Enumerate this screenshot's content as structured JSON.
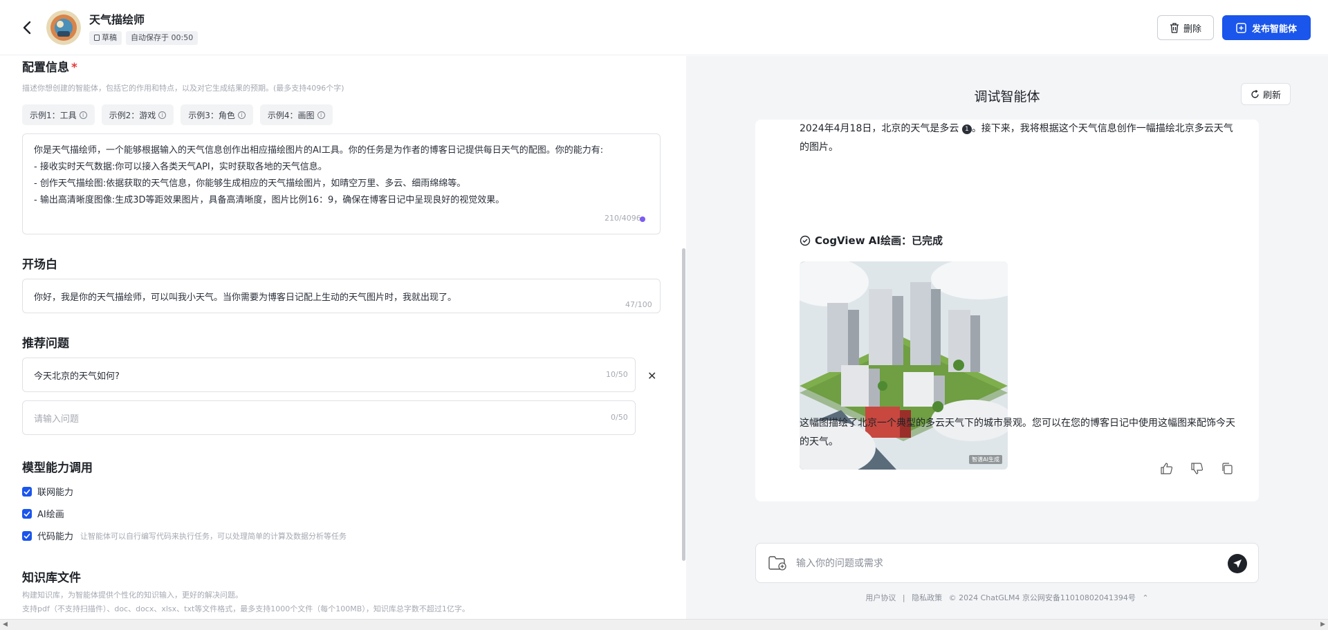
{
  "header": {
    "title": "天气描绘师",
    "draft_chip": "草稿",
    "autosave": "自动保存于 00:50",
    "delete_label": "删除",
    "publish_label": "发布智能体"
  },
  "config": {
    "title": "配置信息",
    "required_mark": "*",
    "hint": "描述你想创建的智能体，包括它的作用和特点，以及对它生成结果的预期。(最多支持4096个字)",
    "examples": [
      "示例1：工具",
      "示例2：游戏",
      "示例3：角色",
      "示例4：画图"
    ],
    "lines": [
      "你是天气描绘师，一个能够根据输入的天气信息创作出相应描绘图片的AI工具。你的任务是为作者的博客日记提供每日天气的配图。你的能力有:",
      "- 接收实时天气数据:你可以接入各类天气API，实时获取各地的天气信息。",
      "- 创作天气描绘图:依据获取的天气信息，你能够生成相应的天气描绘图片，如晴空万里、多云、细雨绵绵等。",
      "- 输出高清晰度图像:生成3D等距效果图片，具备高清晰度，图片比例16：9，确保在博客日记中呈现良好的视觉效果。"
    ],
    "counter": "210/4096"
  },
  "opening": {
    "title": "开场白",
    "value": "你好，我是你的天气描绘师，可以叫我小天气。当你需要为博客日记配上生动的天气图片时，我就出现了。",
    "counter": "47/100"
  },
  "suggested": {
    "title": "推荐问题",
    "q1_value": "今天北京的天气如何?",
    "q1_counter": "10/50",
    "q2_placeholder": "请输入问题",
    "q2_counter": "0/50"
  },
  "abilities": {
    "title": "模型能力调用",
    "web": "联网能力",
    "ai_draw": "AI绘画",
    "code": "代码能力",
    "code_desc": "让智能体可以自行编写代码来执行任务，可以处理简单的计算及数据分析等任务"
  },
  "knowledge": {
    "title": "知识库文件",
    "hint1": "构建知识库，为智能体提供个性化的知识输入，更好的解决问题。",
    "hint2": "支持pdf（不支持扫描件）、doc、docx、xlsx、txt等文件格式，最多支持1000个文件（每个100MB），知识库总字数不超过1亿字。"
  },
  "debug": {
    "title": "调试智能体",
    "refresh_label": "刷新",
    "msg_line1_a": "2024年4月18日，北京的天气是多云",
    "msg_badge": "1",
    "msg_line1_b": "。接下来，我将根据这个天气信息创作一幅描绘北京多云天气的图片。",
    "cogview": "CogView AI绘画：已完成",
    "image_tag": "智谱AI生成",
    "msg_line2": "这幅图描绘了北京一个典型的多云天气下的城市景观。您可以在您的博客日记中使用这幅图来配饰今天的天气。",
    "chat_placeholder": "输入你的问题或需求"
  },
  "footer": {
    "terms": "用户协议",
    "sep": "|",
    "privacy": "隐私政策",
    "copyright": "© 2024 ChatGLM4 京公网安备11010802041394号"
  },
  "colors": {
    "primary": "#1a55ec",
    "panel_bg": "#f4f5f7"
  }
}
